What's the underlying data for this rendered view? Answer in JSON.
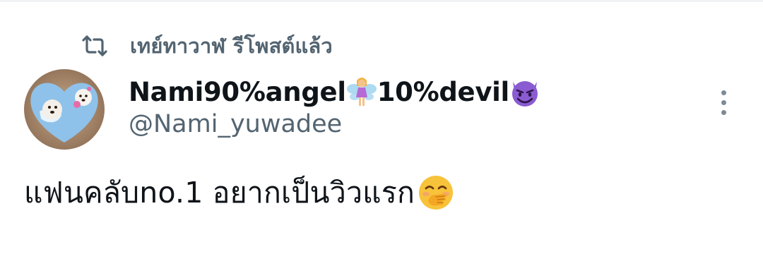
{
  "retweet": {
    "icon": "retweet-icon",
    "text": "เทย์ทาวาฬ รีโพสต์แล้ว"
  },
  "author": {
    "avatar": "avatar-image",
    "name_part1": "Nami90%angel",
    "name_emoji1": "fairy-emoji",
    "name_part2": "10%devil",
    "name_emoji2": "smiling-devil-emoji",
    "handle": "@Nami_yuwadee"
  },
  "tweet": {
    "text": "แฟนคลับno.1 อยากเป็นวิวแรก",
    "emoji": "face-with-hand-over-mouth-emoji"
  },
  "actions": {
    "more_icon": "more-vertical-icon"
  },
  "colors": {
    "primary_text": "#0f1419",
    "secondary_text": "#536471",
    "divider": "#eff3f4",
    "devil_purple": "#8a5bd1"
  }
}
